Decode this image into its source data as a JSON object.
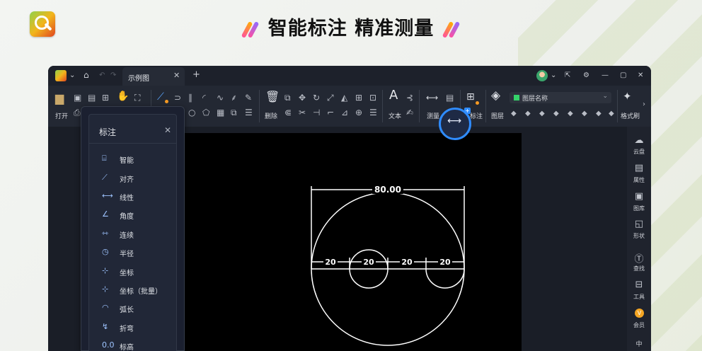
{
  "headline": "智能标注 精准测量",
  "titlebar": {
    "tab_label": "示例图",
    "icons": [
      "app-logo",
      "home-icon",
      "undo-icon",
      "redo-icon",
      "close-icon",
      "plus-icon",
      "avatar",
      "share-icon",
      "settings-icon",
      "minimize-icon",
      "maximize-icon",
      "close-icon"
    ]
  },
  "ribbon": {
    "labels": {
      "open": "打开",
      "delete": "删除",
      "text": "文本",
      "measure": "测量",
      "annotate": "标注",
      "layer": "图层",
      "format_brush": "格式刷"
    },
    "layer_dropdown": "图层名称",
    "layer_color": "#35d36a"
  },
  "sidebar": [
    {
      "label": "云盘"
    },
    {
      "label": "属性"
    },
    {
      "label": "图库"
    },
    {
      "label": "形状"
    },
    {
      "label": "查找"
    },
    {
      "label": "工具"
    },
    {
      "label": "会员"
    },
    {
      "label": "中"
    }
  ],
  "panel": {
    "title": "标注",
    "items": [
      {
        "label": "智能",
        "icon": "smart-dim-icon",
        "glyph": "⌸"
      },
      {
        "label": "对齐",
        "icon": "aligned-dim-icon",
        "glyph": "⟋"
      },
      {
        "label": "线性",
        "icon": "linear-dim-icon",
        "glyph": "⟷"
      },
      {
        "label": "角度",
        "icon": "angle-dim-icon",
        "glyph": "∠"
      },
      {
        "label": "连续",
        "icon": "continuous-dim-icon",
        "glyph": "⇿"
      },
      {
        "label": "半径",
        "icon": "radius-dim-icon",
        "glyph": "◷"
      },
      {
        "label": "坐标",
        "icon": "coordinate-dim-icon",
        "glyph": "⊹"
      },
      {
        "label": "坐标（批量）",
        "icon": "batch-coordinate-dim-icon",
        "glyph": "⊹"
      },
      {
        "label": "弧长",
        "icon": "arc-length-dim-icon",
        "glyph": "◠"
      },
      {
        "label": "折弯",
        "icon": "jogged-dim-icon",
        "glyph": "↯"
      },
      {
        "label": "标高",
        "icon": "elevation-dim-icon",
        "glyph": "0.0"
      }
    ]
  },
  "drawing": {
    "overall_dim": "80.00",
    "segment_dims": [
      "20",
      "20",
      "20",
      "20"
    ]
  },
  "colors": {
    "accent": "#2f8cff",
    "canvas": "#000000",
    "window": "#1a1e27"
  }
}
